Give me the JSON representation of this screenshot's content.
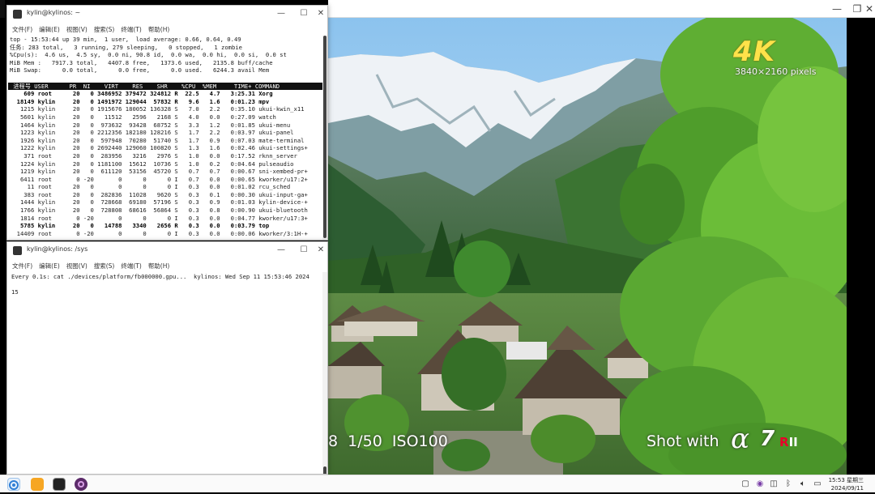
{
  "video": {
    "overlay_4k": "4K",
    "overlay_resolution": "3840×2160 pixels",
    "overlay_exif": "8  1/50  ISO100",
    "overlay_shot_with": "Shot with",
    "overlay_camera_alpha": "α",
    "overlay_camera_model": "7",
    "overlay_camera_r": "R",
    "overlay_camera_ii": "II"
  },
  "top_window": {
    "title": "kylin@kylinos: ~",
    "menus": [
      "文件(F)",
      "编辑(E)",
      "视图(V)",
      "搜索(S)",
      "终端(T)",
      "帮助(H)"
    ],
    "summary": [
      "top - 15:53:44 up 39 min,  1 user,  load average: 0.66, 0.64, 0.49",
      "任务: 283 total,   3 running, 279 sleeping,   0 stopped,   1 zombie",
      "%Cpu(s):  4.6 us,  4.5 sy,  0.0 ni, 90.8 id,  0.0 wa,  0.0 hi,  0.0 si,  0.0 st",
      "MiB Mem :   7917.3 total,   4407.8 free,   1373.6 used,   2135.8 buff/cache",
      "MiB Swap:      0.0 total,      0.0 free,      0.0 used.   6244.3 avail Mem"
    ],
    "header": " 进程号 USER      PR  NI    VIRT    RES    SHR    %CPU  %MEM     TIME+ COMMAND",
    "processes": [
      {
        "line": "    609 root      20   0 3486952 379472 324812 R  22.5   4.7   3:25.31 Xorg",
        "bold": true
      },
      {
        "line": "  18149 kylin     20   0 1491972 129044  57832 R   9.6   1.6   0:01.23 mpv",
        "bold": true
      },
      {
        "line": "   1215 kylin     20   0 1915676 180052 136328 S   7.0   2.2   0:35.10 ukui-kwin_x11",
        "bold": false
      },
      {
        "line": "   5601 kylin     20   0   11512   2596   2168 S   4.0   0.0   0:27.09 watch",
        "bold": false
      },
      {
        "line": "   1464 kylin     20   0  973632  93428  68752 S   3.3   1.2   0:01.85 ukui-menu",
        "bold": false
      },
      {
        "line": "   1223 kylin     20   0 2212356 182180 128216 S   1.7   2.2   0:03.97 ukui-panel",
        "bold": false
      },
      {
        "line": "   1926 kylin     20   0  597948  70280  51740 S   1.7   0.9   0:07.03 mate-terminal",
        "bold": false
      },
      {
        "line": "   1222 kylin     20   0 2692440 129060 100820 S   1.3   1.6   0:02.46 ukui-settings+",
        "bold": false
      },
      {
        "line": "    371 root      20   0  283956   3216   2976 S   1.0   0.0   0:17.52 rknn_server",
        "bold": false
      },
      {
        "line": "   1224 kylin     20   0 1181100  15612  10736 S   1.0   0.2   0:04.64 pulseaudio",
        "bold": false
      },
      {
        "line": "   1219 kylin     20   0  611120  53156  45720 S   0.7   0.7   0:00.67 sni-xembed-pr+",
        "bold": false
      },
      {
        "line": "   6411 root       0 -20       0      0      0 I   0.7   0.0   0:00.65 kworker/u17:2+",
        "bold": false
      },
      {
        "line": "     11 root      20   0       0      0      0 I   0.3   0.0   0:01.02 rcu_sched",
        "bold": false
      },
      {
        "line": "    383 root      20   0  282836  11028   9620 S   0.3   0.1   0:00.30 ukui-input-ga+",
        "bold": false
      },
      {
        "line": "   1444 kylin     20   0  728668  69180  57196 S   0.3   0.9   0:01.03 kylin-device-+",
        "bold": false
      },
      {
        "line": "   1766 kylin     20   0  728808  68616  56864 S   0.3   0.8   0:00.90 ukui-bluetooth",
        "bold": false
      },
      {
        "line": "   1814 root       0 -20       0      0      0 I   0.3   0.0   0:04.77 kworker/u17:3+",
        "bold": false
      },
      {
        "line": "   5785 kylin     20   0   14788   3340   2656 R   0.3   0.0   0:03.79 top",
        "bold": true
      },
      {
        "line": "  14409 root       0 -20       0      0      0 I   0.3   0.0   0:00.06 kworker/3:1H-+",
        "bold": false
      }
    ]
  },
  "sys_window": {
    "title": "kylin@kylinos: /sys",
    "menus": [
      "文件(F)",
      "编辑(E)",
      "视图(V)",
      "搜索(S)",
      "终端(T)",
      "帮助(H)"
    ],
    "watch_line": "Every 0.1s: cat ./devices/platform/fb000000.gpu...  kylinos: Wed Sep 11 15:53:46 2024",
    "output": "15"
  },
  "taskbar": {
    "apps": [
      "start-menu",
      "file-manager",
      "terminal",
      "mpv"
    ],
    "time": "15:53 星期三",
    "date": "2024/09/11"
  },
  "colors": {
    "sky": "#a9d3f3",
    "mountain": "#3f6e3a",
    "snow": "#f2f4f7",
    "foliage": "#5aa832",
    "roof": "#5b4c3d",
    "taskbar": "#fafafa"
  }
}
